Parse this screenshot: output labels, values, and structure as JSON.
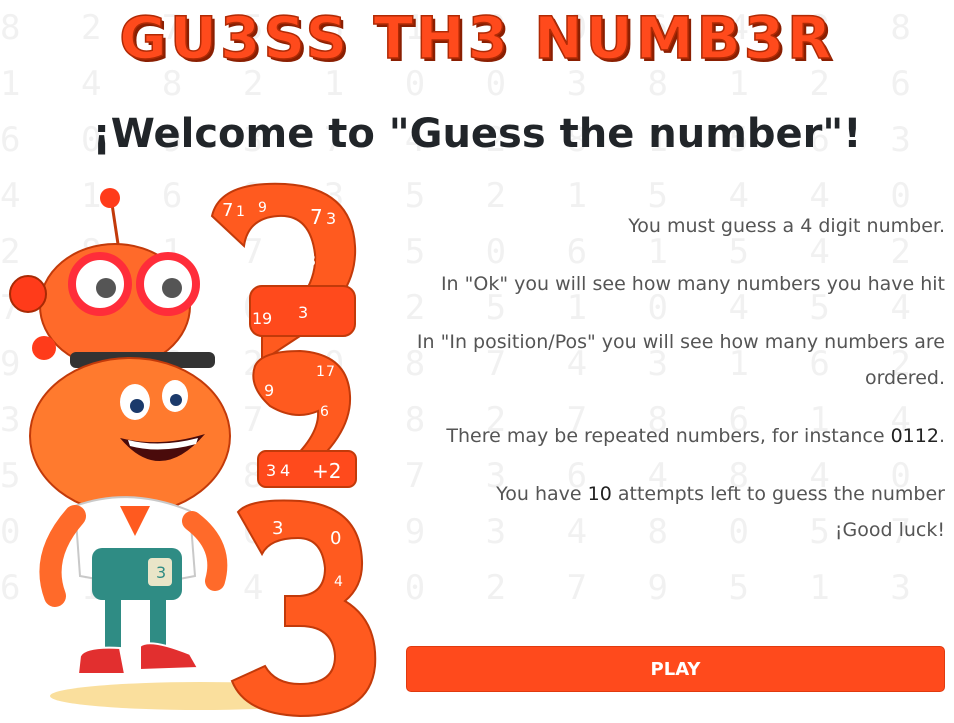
{
  "game": {
    "title": "GU3SS TH3 NUMB3R",
    "welcome": "¡Welcome to \"Guess the number\"!",
    "colors": {
      "accent": "#ff4a1c",
      "text": "#212529"
    }
  },
  "rules": {
    "line1": "You must guess a 4 digit number.",
    "line2": "In \"Ok\" you will see how many numbers you have hit",
    "line3": "In \"In position/Pos\" you will see how many numbers are ordered.",
    "line4_prefix": "There may be repeated numbers, for instance",
    "line4_example": "0112",
    "line4_suffix": ".",
    "line5_prefix": "You have",
    "attempts": "10",
    "line5_suffix": "attempts left to guess the number",
    "good_luck": "¡Good luck!"
  },
  "actions": {
    "play_label": "PLAY"
  },
  "illustration": {
    "icon": "robot-numbers-mascot-icon",
    "digit_labels": [
      "7",
      "1",
      "9",
      "7",
      "3",
      "3",
      "1",
      "9",
      "3",
      "9",
      "1",
      "7",
      "6",
      "3",
      "4",
      "+2",
      "3",
      "0",
      "4",
      "1",
      "0",
      "3"
    ]
  }
}
